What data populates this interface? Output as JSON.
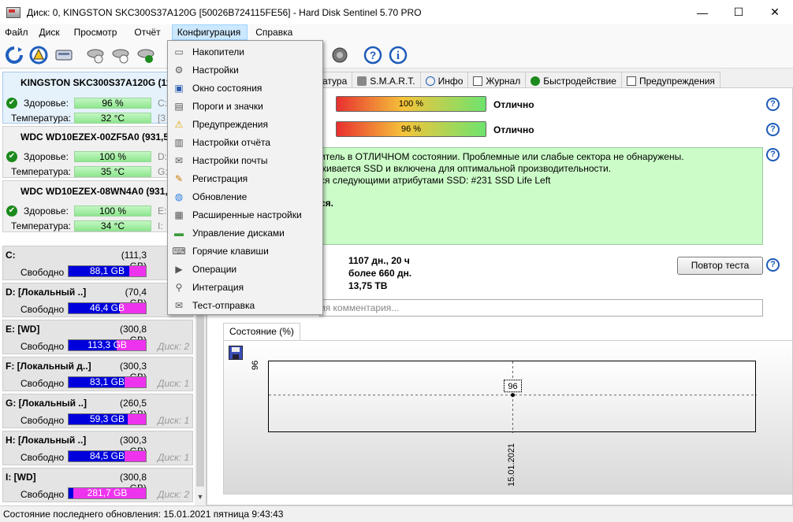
{
  "window": {
    "title": "Диск: 0, KINGSTON SKC300S37A120G [50026B724115FE56]  -  Hard Disk Sentinel 5.70 PRO",
    "minimize": "—",
    "maximize": "☐",
    "close": "✕"
  },
  "menu": [
    "Файл",
    "Диск",
    "Просмотр",
    "Отчёт",
    "Конфигурация",
    "Справка"
  ],
  "disks": [
    {
      "name": "KINGSTON SKC300S37A120G (11",
      "health_label": "Здоровье:",
      "health": "96 %",
      "health_extra": "C:",
      "temp_label": "Температура:",
      "temp": "32 °C",
      "temp_extra": "[3"
    },
    {
      "name": "WDC WD10EZEX-00ZF5A0 (931,5",
      "health_label": "Здоровье:",
      "health": "100 %",
      "health_extra": "D:",
      "temp_label": "Температура:",
      "temp": "35 °C",
      "temp_extra": "G:"
    },
    {
      "name": "WDC WD10EZEX-08WN4A0 (931,5",
      "health_label": "Здоровье:",
      "health": "100 %",
      "health_extra": "E:",
      "temp_label": "Температура:",
      "temp": "34 °C",
      "temp_extra": "I:"
    }
  ],
  "volumes": [
    {
      "name": "C:",
      "size": "(111,3 GB)",
      "free_label": "Свободно",
      "free": "88,1 GB",
      "free_pct": 0.79,
      "disk": ""
    },
    {
      "name": "D: [Локальный ..]",
      "size": "(70,4 GB)",
      "free_label": "Свободно",
      "free": "46,4 GB",
      "free_pct": 0.66,
      "disk": ""
    },
    {
      "name": "E: [WD]",
      "size": "(300,8 GB)",
      "free_label": "Свободно",
      "free": "113,3 GB",
      "free_pct": 0.62,
      "disk": "Диск: 2"
    },
    {
      "name": "F: [Локальный д..]",
      "size": "(300,3 GB)",
      "free_label": "Свободно",
      "free": "83,1 GB",
      "free_pct": 0.72,
      "disk": "Диск: 1"
    },
    {
      "name": "G: [Локальный ..]",
      "size": "(260,5 GB)",
      "free_label": "Свободно",
      "free": "59,3 GB",
      "free_pct": 0.77,
      "disk": "Диск: 1"
    },
    {
      "name": "H: [Локальный ..]",
      "size": "(300,3 GB)",
      "free_label": "Свободно",
      "free": "84,5 GB",
      "free_pct": 0.72,
      "disk": "Диск: 1"
    },
    {
      "name": "I: [WD]",
      "size": "(300,8 GB)",
      "free_label": "Свободно",
      "free": "281,7 GB",
      "free_pct": 0.06,
      "disk": "Диск: 2"
    }
  ],
  "tabs": [
    "атура",
    "S.M.A.R.T.",
    "Инфо",
    "Журнал",
    "Быстродействие",
    "Предупреждения"
  ],
  "overview": {
    "health_value": "100 %",
    "health_rating": "Отлично",
    "performance_value": "96 %",
    "performance_rating": "Отлично",
    "status_lines": [
      "итель в ОТЛИЧНОМ состоянии. Проблемные или слабые сектора не обнаружены.",
      "живается SSD и включена для оптимальной производительности.",
      "ся следующими атрибутами SSD: #231 SSD Life Left",
      "ся."
    ],
    "power_on": "1107 дн., 20 ч",
    "lifetime": "более 660 дн.",
    "written": "13,75 TB",
    "retest_button": "Повтор теста",
    "comment_placeholder": "ия комментария..."
  },
  "chart_tab": "Состояние (%)",
  "chart_data": {
    "type": "line",
    "x": [
      "15.01.2021"
    ],
    "series": [
      {
        "values": [
          96
        ]
      }
    ],
    "ylabel": "",
    "ytick": "96",
    "point_label": "96"
  },
  "statusbar": "Состояние последнего обновления: 15.01.2021 пятница 9:43:43",
  "dropdown": [
    {
      "label": "Накопители",
      "icon": "drives-icon"
    },
    {
      "label": "Настройки",
      "icon": "settings-icon"
    },
    {
      "label": "Окно состояния",
      "icon": "window-icon"
    },
    {
      "label": "Пороги и значки",
      "icon": "thresholds-icon"
    },
    {
      "label": "Предупреждения",
      "icon": "warning-icon"
    },
    {
      "label": "Настройки отчёта",
      "icon": "report-icon"
    },
    {
      "label": "Настройки почты",
      "icon": "mail-icon"
    },
    {
      "label": "Регистрация",
      "icon": "registration-icon"
    },
    {
      "label": "Обновление",
      "icon": "globe-icon"
    },
    {
      "label": "Расширенные настройки",
      "icon": "advanced-icon"
    },
    {
      "label": "Управление дисками",
      "icon": "disk-management-icon"
    },
    {
      "label": "Горячие клавиши",
      "icon": "keyboard-icon"
    },
    {
      "label": "Операции",
      "icon": "operations-icon"
    },
    {
      "label": "Интеграция",
      "icon": "integration-icon"
    },
    {
      "label": "Тест-отправка",
      "icon": "test-send-icon"
    }
  ],
  "colors": {
    "accent": "#1e5bb8",
    "health_ok": "#1c8a1c",
    "free_bar": "#0000dd",
    "used_bar": "#ee33ee",
    "status_bg": "#ccfcc8"
  }
}
